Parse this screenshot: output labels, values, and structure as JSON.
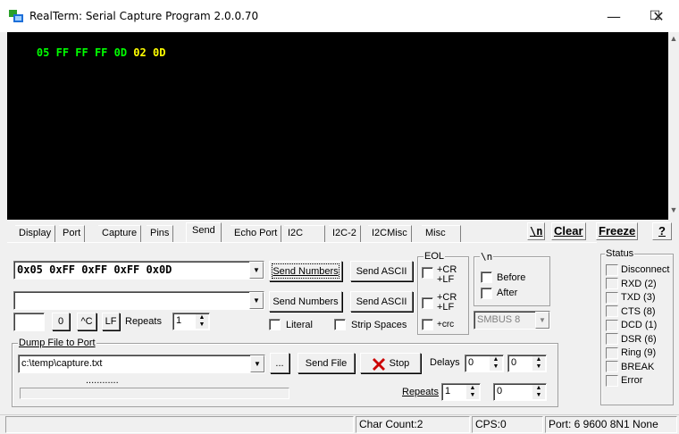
{
  "window": {
    "title": "RealTerm: Serial Capture Program 2.0.0.70",
    "minimize_glyph": "—",
    "maximize_glyph": "☐",
    "close_glyph": "✕"
  },
  "terminal": {
    "tokens": [
      {
        "text": "05 ",
        "color": "#00ff00"
      },
      {
        "text": "FF FF FF 0D ",
        "color": "#00ff00"
      },
      {
        "text": "02 0D",
        "color": "#ffff00"
      }
    ],
    "scroll_up": "▲",
    "scroll_down": "▼"
  },
  "tabs": [
    {
      "label": "Display",
      "active": false
    },
    {
      "label": "Port",
      "active": false
    },
    {
      "label": "Capture",
      "active": false
    },
    {
      "label": "Pins",
      "active": false
    },
    {
      "label": "Send",
      "active": true
    },
    {
      "label": "Echo Port",
      "active": false
    },
    {
      "label": "I2C",
      "active": false
    },
    {
      "label": "I2C-2",
      "active": false
    },
    {
      "label": "I2CMisc",
      "active": false
    },
    {
      "label": "Misc",
      "active": false
    }
  ],
  "toolbar": {
    "newline_label": "\\n",
    "clear_label": "Clear",
    "freeze_label": "Freeze",
    "help_label": "?"
  },
  "send": {
    "line1_value": "0x05 0xFF 0xFF 0xFF 0x0D",
    "line2_value": "",
    "send_numbers_label": "Send Numbers",
    "send_ascii_label": "Send ASCII",
    "eol_title": "EOL",
    "eol1": [
      "+CR",
      "+LF"
    ],
    "eol2": [
      "+CR",
      "+LF",
      "+crc"
    ],
    "nl_title": "\\n",
    "before_label": "Before",
    "after_label": "After",
    "smbus_value": "SMBUS 8",
    "small_input_value": "",
    "zero_btn": "0",
    "ctrl_c_btn": "^C",
    "lf_btn": "LF",
    "repeats_label": "Repeats",
    "repeats_value": "1",
    "literal_label": "Literal",
    "strip_spaces_label": "Strip Spaces"
  },
  "dump": {
    "title": "Dump File to Port",
    "file_value": "c:\\temp\\capture.txt",
    "browse_label": "...",
    "send_file_label": "Send File",
    "stop_label": "Stop",
    "delays_label": "Delays",
    "delay1": "0",
    "delay2": "0",
    "repeats_label": "Repeats",
    "repeats1": "1",
    "repeats2": "0",
    "progress_dots": "............",
    "progress_fraction": 0
  },
  "status": {
    "title": "Status",
    "items": [
      "Disconnect",
      "RXD (2)",
      "TXD (3)",
      "CTS (8)",
      "DCD (1)",
      "DSR (6)",
      "Ring (9)",
      "BREAK",
      "Error"
    ]
  },
  "statusbar": {
    "char_count": "Char Count:2",
    "cps": "CPS:0",
    "port": "Port: 6 9600 8N1 None"
  },
  "colors": {
    "terminal_bg": "#000000",
    "stop_icon": "#cc0000",
    "icon_blue": "#1e6fd9",
    "icon_green": "#2aa02a"
  }
}
